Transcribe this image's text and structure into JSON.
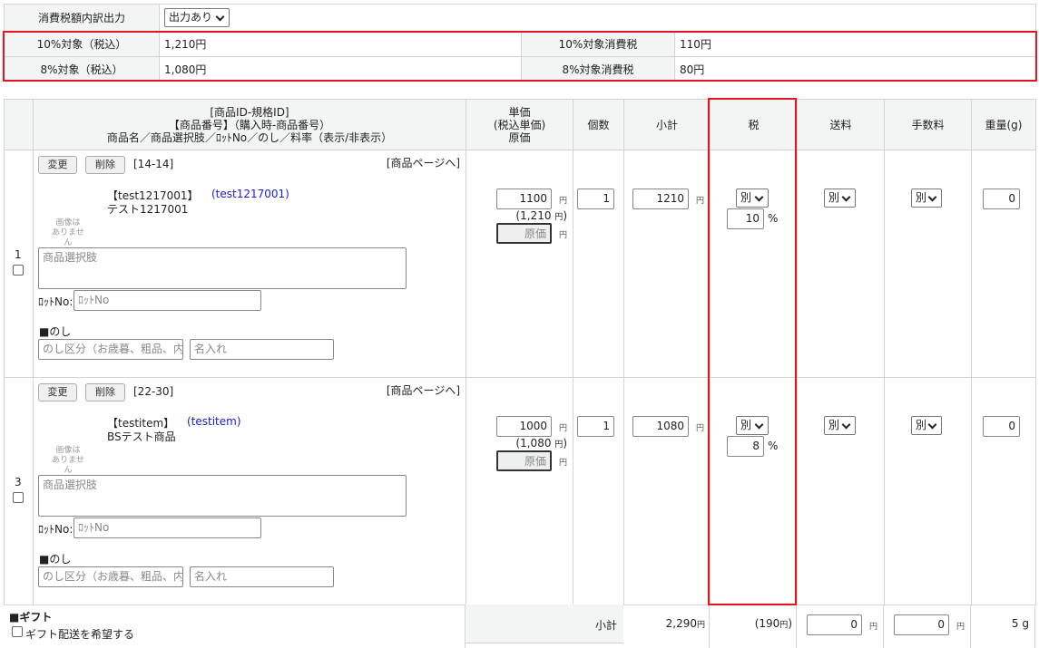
{
  "tax_summary": {
    "output_label": "消費税額内訳出力",
    "output_value": "出力あり",
    "rows": [
      {
        "label": "10%対象（税込）",
        "value": "1,210円",
        "tax_label": "10%対象消費税",
        "tax_value": "110円"
      },
      {
        "label": "8%対象（税込）",
        "value": "1,080円",
        "tax_label": "8%対象消費税",
        "tax_value": "80円"
      }
    ]
  },
  "headers": {
    "product_line1": "[商品ID-規格ID]",
    "product_line2": "【商品番号】（購入時-商品番号）",
    "product_line3": "商品名／商品選択肢／ﾛｯﾄNo／のし／料率（表示/非表示）",
    "price_line1": "単価",
    "price_line2": "(税込単価)",
    "price_line3": "原価",
    "qty": "個数",
    "subtotal": "小計",
    "tax": "税",
    "shipping": "送料",
    "fee": "手数料",
    "weight": "重量(g)"
  },
  "common": {
    "change": "変更",
    "delete": "削除",
    "product_page": "[商品ページへ]",
    "no_image_1": "画像は",
    "no_image_2": "ありません",
    "option_placeholder": "商品選択肢",
    "lot_label": "ﾛｯﾄNo:",
    "lot_placeholder": "ﾛｯﾄNo",
    "noshi_label": "■のし",
    "noshi_placeholder": "のし区分（お歳暮、粗品、内",
    "name_placeholder": "名入れ",
    "yen": "円",
    "cost_placeholder": "原価",
    "percent": "%"
  },
  "items": [
    {
      "row": "1",
      "ids": "[14-14]",
      "code": "【test1217001】",
      "code_link": "(test1217001)",
      "name": "テスト1217001",
      "price": "1100",
      "price_incl": "(1,210",
      "price_incl_end": ")",
      "qty": "1",
      "subtotal": "1210",
      "tax_type": "別",
      "tax_rate": "10",
      "shipping_type": "別",
      "fee_type": "別",
      "weight": "0"
    },
    {
      "row": "3",
      "ids": "[22-30]",
      "code": "【testitem】",
      "code_link": "(testitem)",
      "name": "BSテスト商品",
      "price": "1000",
      "price_incl": "(1,080",
      "price_incl_end": ")",
      "qty": "1",
      "subtotal": "1080",
      "tax_type": "別",
      "tax_rate": "8",
      "shipping_type": "別",
      "fee_type": "別",
      "weight": "0"
    }
  ],
  "footer": {
    "gift_label": "■ギフト",
    "gift_checkbox": "ギフト配送を希望する",
    "subtotal_label": "小計",
    "subtotal": "2,290",
    "tax": "(190",
    "tax_end": ")",
    "shipping": "0",
    "fee": "0",
    "weight": "5 g"
  },
  "colors": {
    "highlight": "#e5141e",
    "link": "#1a1adb"
  }
}
